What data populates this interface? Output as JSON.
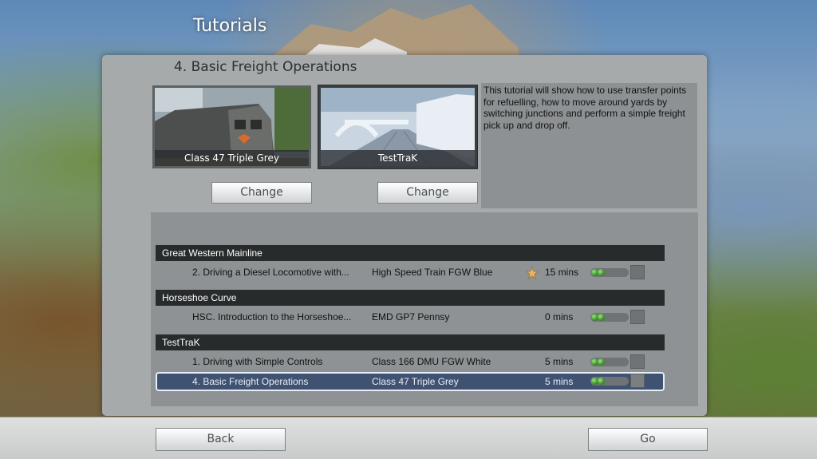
{
  "screen": {
    "title": "Tutorials"
  },
  "tutorial": {
    "heading": "4. Basic Freight Operations",
    "description": "This tutorial will show how to use transfer points for refuelling, how to move around yards by switching junctions and perform a simple freight pick up and drop off.",
    "locomotive_caption": "Class 47 Triple Grey",
    "route_caption": "TestTraK",
    "change_label": "Change"
  },
  "list": {
    "groups": [
      {
        "name": "Great Western Mainline",
        "rows": [
          {
            "name": "2. Driving a Diesel Locomotive with...",
            "loco": "High Speed Train FGW Blue",
            "time": "15 mins",
            "starred": true,
            "selected": false
          }
        ]
      },
      {
        "name": "Horseshoe Curve",
        "rows": [
          {
            "name": "HSC. Introduction to the Horseshoe...",
            "loco": "EMD GP7 Pennsy",
            "time": "0 mins",
            "starred": false,
            "selected": false
          }
        ]
      },
      {
        "name": "TestTraK",
        "rows": [
          {
            "name": "1. Driving with Simple Controls",
            "loco": "Class 166 DMU FGW White",
            "time": "5 mins",
            "starred": false,
            "selected": false
          },
          {
            "name": "4. Basic Freight Operations",
            "loco": "Class 47 Triple Grey",
            "time": "5 mins",
            "starred": false,
            "selected": true
          }
        ]
      }
    ]
  },
  "footer": {
    "back_label": "Back",
    "go_label": "Go"
  },
  "icons": {
    "favourite": "star-icon",
    "progress": "progress-dots-icon",
    "checkbox": "checkbox-icon"
  },
  "colors": {
    "selected_row": "#3f5272",
    "group_header": "#282b2c",
    "panel": "#a6aaab"
  }
}
